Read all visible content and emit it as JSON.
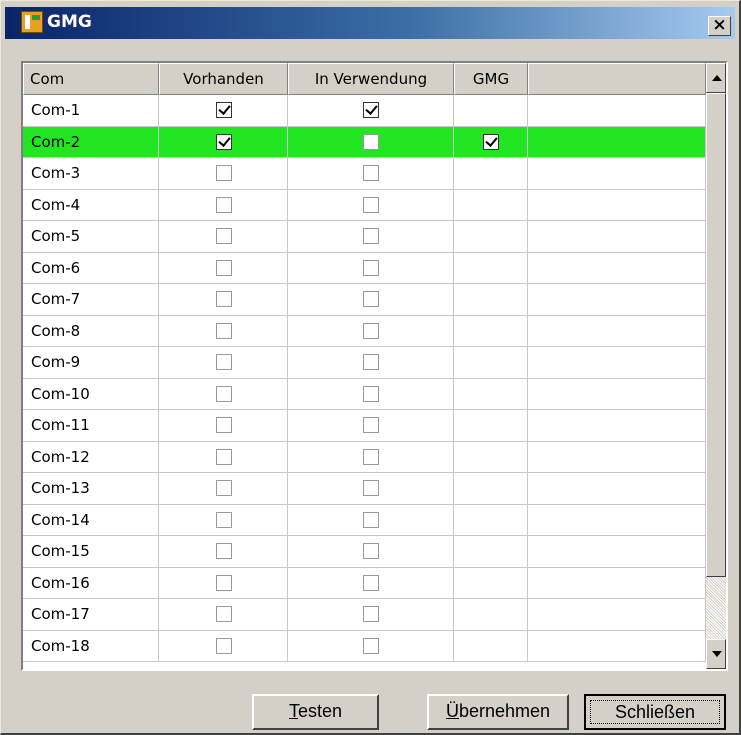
{
  "window": {
    "title": "GMG",
    "close_label": "×"
  },
  "table": {
    "columns": [
      "Com",
      "Vorhanden",
      "In Verwendung",
      "GMG"
    ],
    "rows": [
      {
        "label": "Com-1",
        "vorhanden": true,
        "in_verwendung": true,
        "gmg": false,
        "selected": false
      },
      {
        "label": "Com-2",
        "vorhanden": true,
        "in_verwendung": false,
        "gmg": true,
        "selected": true
      },
      {
        "label": "Com-3",
        "vorhanden": false,
        "in_verwendung": false,
        "gmg": false,
        "selected": false
      },
      {
        "label": "Com-4",
        "vorhanden": false,
        "in_verwendung": false,
        "gmg": false,
        "selected": false
      },
      {
        "label": "Com-5",
        "vorhanden": false,
        "in_verwendung": false,
        "gmg": false,
        "selected": false
      },
      {
        "label": "Com-6",
        "vorhanden": false,
        "in_verwendung": false,
        "gmg": false,
        "selected": false
      },
      {
        "label": "Com-7",
        "vorhanden": false,
        "in_verwendung": false,
        "gmg": false,
        "selected": false
      },
      {
        "label": "Com-8",
        "vorhanden": false,
        "in_verwendung": false,
        "gmg": false,
        "selected": false
      },
      {
        "label": "Com-9",
        "vorhanden": false,
        "in_verwendung": false,
        "gmg": false,
        "selected": false
      },
      {
        "label": "Com-10",
        "vorhanden": false,
        "in_verwendung": false,
        "gmg": false,
        "selected": false
      },
      {
        "label": "Com-11",
        "vorhanden": false,
        "in_verwendung": false,
        "gmg": false,
        "selected": false
      },
      {
        "label": "Com-12",
        "vorhanden": false,
        "in_verwendung": false,
        "gmg": false,
        "selected": false
      },
      {
        "label": "Com-13",
        "vorhanden": false,
        "in_verwendung": false,
        "gmg": false,
        "selected": false
      },
      {
        "label": "Com-14",
        "vorhanden": false,
        "in_verwendung": false,
        "gmg": false,
        "selected": false
      },
      {
        "label": "Com-15",
        "vorhanden": false,
        "in_verwendung": false,
        "gmg": false,
        "selected": false
      },
      {
        "label": "Com-16",
        "vorhanden": false,
        "in_verwendung": false,
        "gmg": false,
        "selected": false
      },
      {
        "label": "Com-17",
        "vorhanden": false,
        "in_verwendung": false,
        "gmg": false,
        "selected": false
      },
      {
        "label": "Com-18",
        "vorhanden": false,
        "in_verwendung": false,
        "gmg": false,
        "selected": false
      }
    ],
    "selected_color": "#22e622"
  },
  "buttons": {
    "testen": {
      "mnemonic": "T",
      "rest": "esten"
    },
    "uebernehmen": {
      "mnemonic": "Ü",
      "rest": "bernehmen"
    },
    "schliessen": "Schließen"
  },
  "icons": {
    "app": "app-icon",
    "close": "close-icon",
    "scroll_up": "scroll-up-arrow-icon",
    "scroll_down": "scroll-down-arrow-icon",
    "check": "checkmark-icon"
  }
}
